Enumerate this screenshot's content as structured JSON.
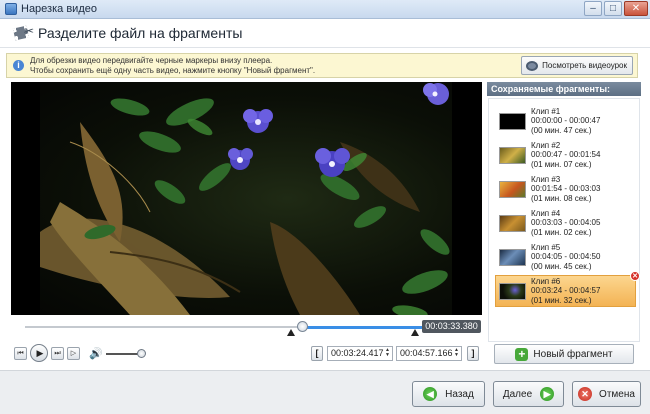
{
  "window": {
    "title": "Нарезка видео",
    "controls": [
      "–",
      "□",
      "✕"
    ]
  },
  "header": {
    "title": "Разделите файл на фрагменты",
    "icon": "film-scissors-icon"
  },
  "info": {
    "line1": "Для обрезки видео передвигайте черные маркеры внизу плеера.",
    "line2": "Чтобы сохранить ещё одну часть видео, нажмите кнопку \"Новый фрагмент\".",
    "preview_button": "Посмотреть видеоурок"
  },
  "player": {
    "current_time": "00:03:33.380",
    "playhead_fraction": 0.72,
    "start_field": "00:03:24.417",
    "end_field": "00:04:57.166",
    "volume_fraction": 0.85,
    "buttons": {
      "prev": "⏮",
      "play": "▶",
      "next": "⏭",
      "frame": "▷",
      "volume": "🔊",
      "bracket_open": "[",
      "bracket_close": "]"
    }
  },
  "sidebar": {
    "header": "Сохраняемые фрагменты:",
    "clips": [
      {
        "name": "Клип #1",
        "range": "00:00:00 - 00:00:47",
        "duration": "(00 мин. 47 сек.)",
        "thumb": "#000000"
      },
      {
        "name": "Клип #2",
        "range": "00:00:47 - 00:01:54",
        "duration": "(01 мин. 07 сек.)",
        "thumb": "#b59a2e"
      },
      {
        "name": "Клип #3",
        "range": "00:01:54 - 00:03:03",
        "duration": "(01 мин. 08 сек.)",
        "thumb": "#cf8a2a"
      },
      {
        "name": "Клип #4",
        "range": "00:03:03 - 00:04:05",
        "duration": "(01 мин. 02 сек.)",
        "thumb": "#9b6a22"
      },
      {
        "name": "Клип #5",
        "range": "00:04:05 - 00:04:50",
        "duration": "(00 мин. 45 сек.)",
        "thumb": "#2e4a6a"
      },
      {
        "name": "Клип #6",
        "range": "00:03:24 - 00:04:57",
        "duration": "(01 мин. 32 сек.)",
        "thumb": "#3a2a5a"
      }
    ],
    "selected_index": 5,
    "new_fragment_button": "Новый фрагмент"
  },
  "footer": {
    "back": "Назад",
    "next": "Далее",
    "cancel": "Отмена"
  },
  "colors": {
    "accent": "#3a8ee6",
    "selected_clip": "#f3b354",
    "info_bg": "#fcf7d2"
  }
}
